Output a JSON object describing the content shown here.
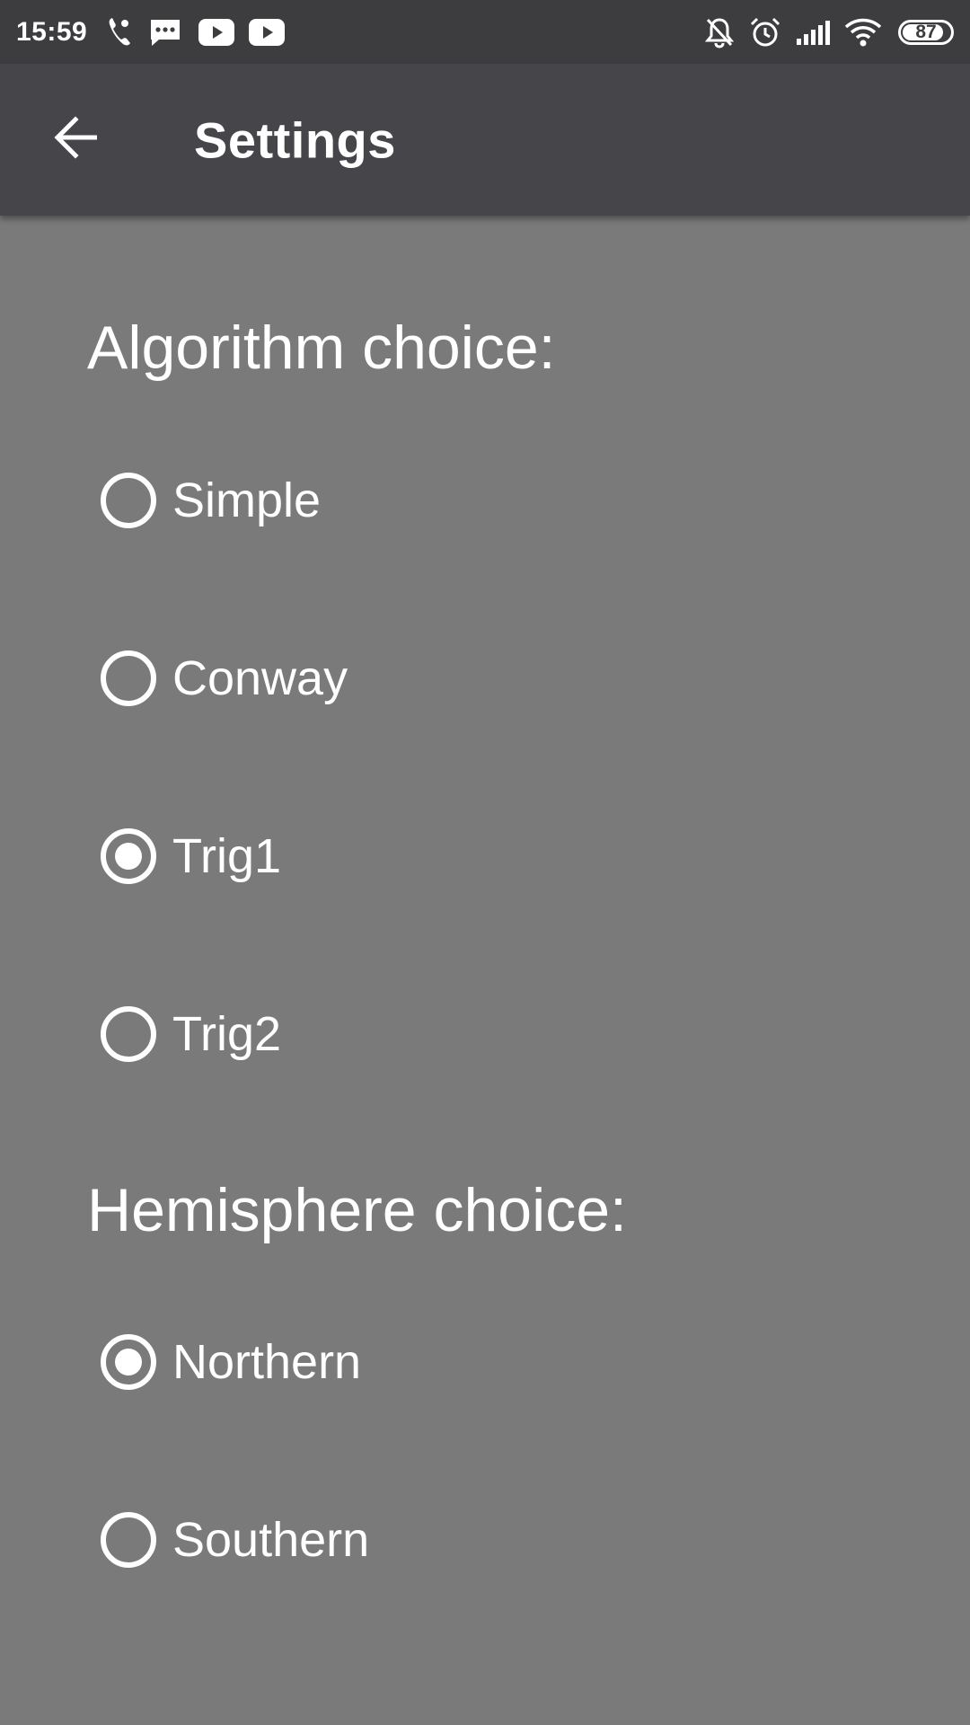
{
  "status_bar": {
    "time": "15:59",
    "battery_level": "87",
    "battery_fraction": 0.87,
    "left_icons": [
      "missed-call-icon",
      "message-icon",
      "youtube-icon",
      "youtube-icon"
    ],
    "right_icons": [
      "bell-off-icon",
      "alarm-icon",
      "signal-icon",
      "wifi-icon",
      "battery-icon"
    ]
  },
  "app_bar": {
    "back_icon": "arrow-left-icon",
    "title": "Settings"
  },
  "algorithm": {
    "heading": "Algorithm choice:",
    "options": [
      {
        "label": "Simple",
        "selected": false
      },
      {
        "label": "Conway",
        "selected": false
      },
      {
        "label": "Trig1",
        "selected": true
      },
      {
        "label": "Trig2",
        "selected": false
      }
    ]
  },
  "hemisphere": {
    "heading": "Hemisphere choice:",
    "options": [
      {
        "label": "Northern",
        "selected": true
      },
      {
        "label": "Southern",
        "selected": false
      }
    ]
  },
  "colors": {
    "status_bar_bg": "#3d3d3f",
    "app_bar_bg": "#464549",
    "content_bg": "#7a7a7a",
    "foreground": "#ffffff"
  }
}
